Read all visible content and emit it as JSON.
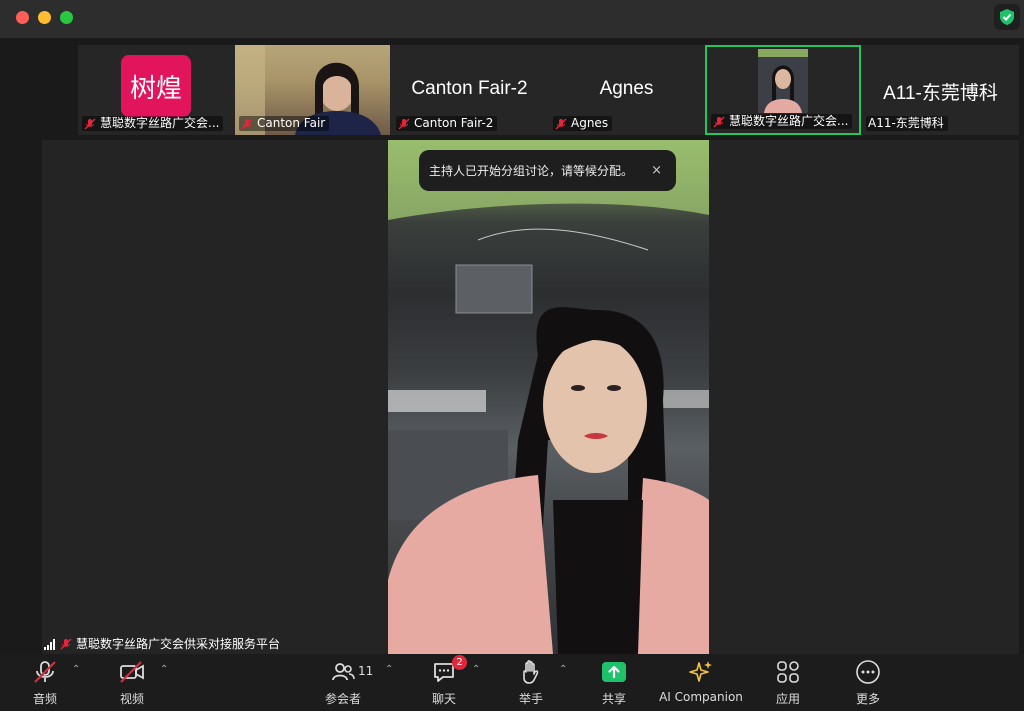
{
  "window": {
    "controls": [
      "close",
      "minimize",
      "zoom"
    ],
    "security_icon": "shield-check-icon"
  },
  "gallery": [
    {
      "display": "树煌",
      "name": "慧聪数字丝路广交会...",
      "muted": true,
      "kind": "logo"
    },
    {
      "display": "",
      "name": "Canton Fair",
      "muted": true,
      "kind": "video"
    },
    {
      "display": "Canton Fair-2",
      "name": "Canton Fair-2",
      "muted": true,
      "kind": "name"
    },
    {
      "display": "Agnes",
      "name": "Agnes",
      "muted": true,
      "kind": "name"
    },
    {
      "display": "",
      "name": "慧聪数字丝路广交会...",
      "muted": true,
      "kind": "video",
      "active": true
    },
    {
      "display": "A11-东莞博科",
      "name": "A11-东莞博科",
      "muted": false,
      "kind": "name"
    }
  ],
  "notification": {
    "text": "主持人已开始分组讨论，请等候分配。",
    "close": "×"
  },
  "speaker": {
    "name": "慧聪数字丝路广交会供采对接服务平台"
  },
  "toolbar": {
    "audio": "音频",
    "video": "视频",
    "participants": "参会者",
    "participants_count": "11",
    "chat": "聊天",
    "chat_badge": "2",
    "raise_hand": "举手",
    "share": "共享",
    "ai_companion": "AI Companion",
    "apps": "应用",
    "more": "更多"
  },
  "colors": {
    "active_border": "#22c55e",
    "share_green": "#1fc16b",
    "muted_red": "#e5263a",
    "logo_bg": "#e2145b",
    "ai_yellow": "#f5c542"
  }
}
